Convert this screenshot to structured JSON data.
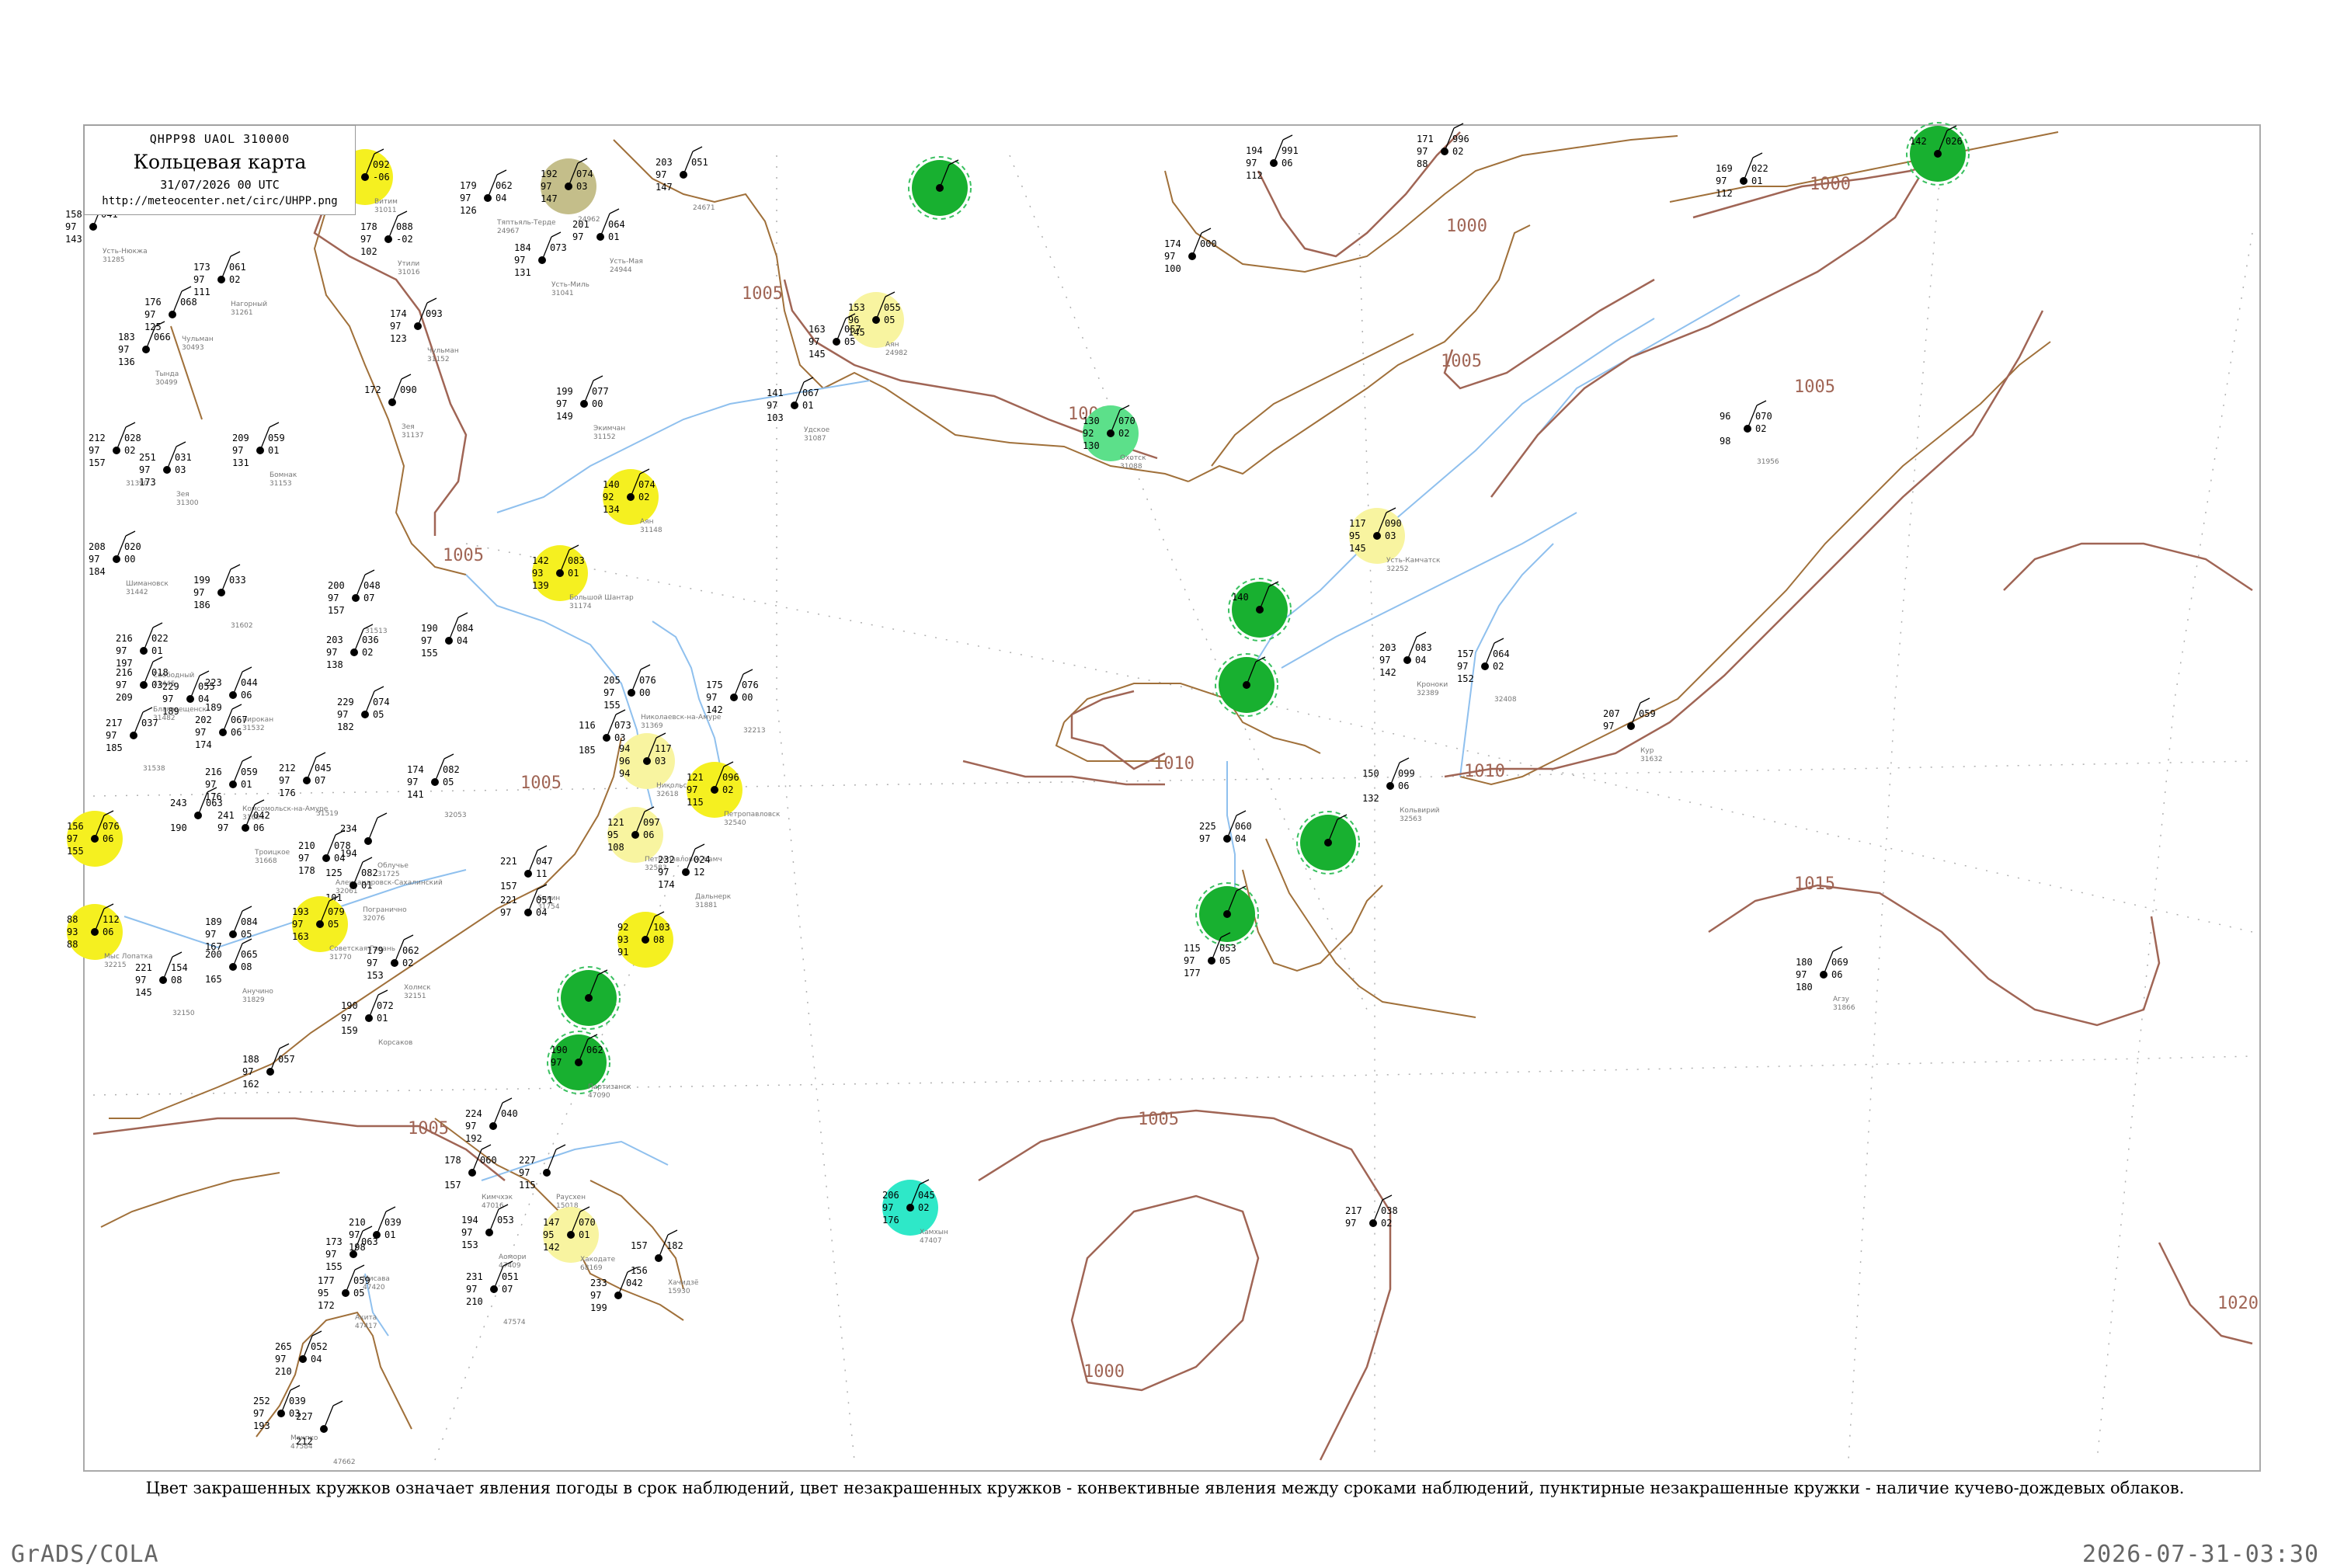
{
  "header": {
    "code": "QHPP98  UAOL  310000",
    "title": "Кольцевая карта",
    "datetime": "31/07/2026 00 UTC",
    "url": "http://meteocenter.net/circ/UHPP.png"
  },
  "caption": "Цвет закрашенных кружков означает явления погоды в срок наблюдений, цвет незакрашенных кружков - конвективные явления между сроками наблюдений, пунктирные незакрашенные кружки - наличие кучево-дождевых облаков.",
  "footer": {
    "left": "GrADS/COLA",
    "right": "2026-07-31-03:30"
  },
  "colors": {
    "yellow": "#f5f020",
    "light_yellow": "#f8f4a0",
    "green": "#18b030",
    "light_green": "#5ce08a",
    "cyan": "#2ee8c8",
    "khaki": "#c4be8a",
    "isobar": "#a06555",
    "coast": "#a0703a",
    "river": "#8fc0ee"
  },
  "isobar_labels": [
    "1005",
    "1005",
    "1005",
    "1005",
    "1010",
    "1010",
    "1000",
    "1000",
    "1005",
    "1000",
    "1015",
    "1020",
    "1005",
    "1005",
    "1000"
  ],
  "stations": [
    {
      "t": "162",
      "td": "97",
      "p": "120",
      "pp": "092",
      "dp": "-06",
      "name": "Витим",
      "id": "31011",
      "fill": "yellow"
    },
    {
      "t": "192",
      "td": "97",
      "p": "147",
      "pp": "074",
      "dp": "03",
      "name": "",
      "id": "24962",
      "fill": "khaki"
    },
    {
      "t": "203",
      "td": "97",
      "p": "147",
      "pp": "051",
      "dp": "",
      "name": "",
      "id": "24671",
      "fill": ""
    },
    {
      "t": "",
      "td": "",
      "p": "",
      "pp": "",
      "dp": "",
      "name": "",
      "id": "",
      "fill": "green"
    },
    {
      "t": "194",
      "td": "97",
      "p": "112",
      "pp": "991",
      "dp": "06",
      "name": "",
      "id": "",
      "fill": ""
    },
    {
      "t": "171",
      "td": "97",
      "p": "88",
      "pp": "996",
      "dp": "02",
      "name": "",
      "id": "",
      "fill": ""
    },
    {
      "t": "169",
      "td": "97",
      "p": "112",
      "pp": "022",
      "dp": "01",
      "name": "",
      "id": "",
      "fill": ""
    },
    {
      "t": "142",
      "td": "",
      "p": "",
      "pp": "026",
      "dp": "",
      "name": "",
      "id": "",
      "fill": "green"
    },
    {
      "t": "158",
      "td": "97",
      "p": "143",
      "pp": "041",
      "dp": "",
      "name": "Усть-Нюкжа",
      "id": "31285",
      "fill": ""
    },
    {
      "t": "179",
      "td": "97",
      "p": "126",
      "pp": "062",
      "dp": "04",
      "name": "Тяптьяль-Терде",
      "id": "24967",
      "fill": ""
    },
    {
      "t": "178",
      "td": "97",
      "p": "102",
      "pp": "088",
      "dp": "-02",
      "name": "Утили",
      "id": "31016",
      "fill": ""
    },
    {
      "t": "201",
      "td": "97",
      "p": "",
      "pp": "064",
      "dp": "01",
      "name": "Усть-Мая",
      "id": "24944",
      "fill": ""
    },
    {
      "t": "184",
      "td": "97",
      "p": "131",
      "pp": "073",
      "dp": "",
      "name": "Усть-Миль",
      "id": "31041",
      "fill": ""
    },
    {
      "t": "173",
      "td": "97",
      "p": "111",
      "pp": "061",
      "dp": "02",
      "name": "Нагорный",
      "id": "31261",
      "fill": ""
    },
    {
      "t": "176",
      "td": "97",
      "p": "125",
      "pp": "068",
      "dp": "",
      "name": "Чульман",
      "id": "30493",
      "fill": ""
    },
    {
      "t": "174",
      "td": "97",
      "p": "123",
      "pp": "093",
      "dp": "",
      "name": "Чульман",
      "id": "31152",
      "fill": ""
    },
    {
      "t": "174",
      "td": "97",
      "p": "100",
      "pp": "000",
      "dp": "",
      "name": "",
      "id": "",
      "fill": ""
    },
    {
      "t": "153",
      "td": "96",
      "p": "145",
      "pp": "055",
      "dp": "05",
      "name": "Аян",
      "id": "24982",
      "fill": "light_yellow"
    },
    {
      "t": "163",
      "td": "97",
      "p": "145",
      "pp": "057",
      "dp": "05",
      "name": "",
      "id": "",
      "fill": ""
    },
    {
      "t": "183",
      "td": "97",
      "p": "136",
      "pp": "066",
      "dp": "",
      "name": "Тында",
      "id": "30499",
      "fill": ""
    },
    {
      "t": "172",
      "td": "",
      "p": "",
      "pp": "090",
      "dp": "",
      "name": "Зея",
      "id": "31137",
      "fill": ""
    },
    {
      "t": "199",
      "td": "97",
      "p": "149",
      "pp": "077",
      "dp": "00",
      "name": "Экимчан",
      "id": "31152",
      "fill": ""
    },
    {
      "t": "141",
      "td": "97",
      "p": "103",
      "pp": "067",
      "dp": "01",
      "name": "Удское",
      "id": "31087",
      "fill": ""
    },
    {
      "t": "130",
      "td": "92",
      "p": "130",
      "pp": "070",
      "dp": "02",
      "name": "Охотск",
      "id": "31088",
      "fill": "light_green"
    },
    {
      "t": "96",
      "td": "",
      "p": "98",
      "pp": "070",
      "dp": "02",
      "name": "",
      "id": "31956",
      "fill": ""
    },
    {
      "t": "212",
      "td": "97",
      "p": "157",
      "pp": "028",
      "dp": "02",
      "name": "",
      "id": "31390",
      "fill": ""
    },
    {
      "t": "209",
      "td": "97",
      "p": "131",
      "pp": "059",
      "dp": "01",
      "name": "Бомнак",
      "id": "31153",
      "fill": ""
    },
    {
      "t": "251",
      "td": "97",
      "p": "173",
      "pp": "031",
      "dp": "03",
      "name": "Зея",
      "id": "31300",
      "fill": ""
    },
    {
      "t": "140",
      "td": "92",
      "p": "134",
      "pp": "074",
      "dp": "02",
      "name": "Аян",
      "id": "31148",
      "fill": "yellow"
    },
    {
      "t": "117",
      "td": "95",
      "p": "145",
      "pp": "090",
      "dp": "03",
      "name": "Усть-Камчатск",
      "id": "32252",
      "fill": "light_yellow"
    },
    {
      "t": "208",
      "td": "97",
      "p": "184",
      "pp": "020",
      "dp": "00",
      "name": "Шимановск",
      "id": "31442",
      "fill": ""
    },
    {
      "t": "199",
      "td": "97",
      "p": "186",
      "pp": "033",
      "dp": "",
      "name": "",
      "id": "31602",
      "fill": ""
    },
    {
      "t": "142",
      "td": "93",
      "p": "139",
      "pp": "083",
      "dp": "01",
      "name": "Большой Шантар",
      "id": "31174",
      "fill": "yellow"
    },
    {
      "t": "200",
      "td": "97",
      "p": "157",
      "pp": "048",
      "dp": "07",
      "name": "",
      "id": "31513",
      "fill": ""
    },
    {
      "t": "140",
      "td": "",
      "p": "",
      "pp": "",
      "dp": "",
      "name": "",
      "id": "",
      "fill": "green"
    },
    {
      "t": "216",
      "td": "97",
      "p": "197",
      "pp": "022",
      "dp": "01",
      "name": "Свободный",
      "id": "31445",
      "fill": ""
    },
    {
      "t": "203",
      "td": "97",
      "p": "138",
      "pp": "036",
      "dp": "02",
      "name": "",
      "id": "",
      "fill": ""
    },
    {
      "t": "190",
      "td": "97",
      "p": "155",
      "pp": "084",
      "dp": "04",
      "name": "",
      "id": "",
      "fill": ""
    },
    {
      "t": "203",
      "td": "97",
      "p": "142",
      "pp": "083",
      "dp": "04",
      "name": "Кроноки",
      "id": "32389",
      "fill": ""
    },
    {
      "t": "157",
      "td": "97",
      "p": "152",
      "pp": "064",
      "dp": "02",
      "name": "",
      "id": "32408",
      "fill": ""
    },
    {
      "t": "216",
      "td": "97",
      "p": "209",
      "pp": "018",
      "dp": "03",
      "name": "Благовещенск",
      "id": "31482",
      "fill": ""
    },
    {
      "t": "229",
      "td": "97",
      "p": "189",
      "pp": "055",
      "dp": "04",
      "name": "",
      "id": "",
      "fill": ""
    },
    {
      "t": "223",
      "td": "",
      "p": "189",
      "pp": "044",
      "dp": "06",
      "name": "Бирокан",
      "id": "31532",
      "fill": ""
    },
    {
      "t": "205",
      "td": "97",
      "p": "155",
      "pp": "076",
      "dp": "00",
      "name": "Николаевск-на-Амуре",
      "id": "31369",
      "fill": ""
    },
    {
      "t": "175",
      "td": "97",
      "p": "142",
      "pp": "076",
      "dp": "00",
      "name": "",
      "id": "32213",
      "fill": ""
    },
    {
      "t": "",
      "td": "",
      "p": "",
      "pp": "",
      "dp": "",
      "name": "",
      "id": "",
      "fill": "green"
    },
    {
      "t": "217",
      "td": "97",
      "p": "185",
      "pp": "037",
      "dp": "",
      "name": "",
      "id": "31538",
      "fill": ""
    },
    {
      "t": "202",
      "td": "97",
      "p": "174",
      "pp": "067",
      "dp": "06",
      "name": "",
      "id": "",
      "fill": ""
    },
    {
      "t": "229",
      "td": "97",
      "p": "182",
      "pp": "074",
      "dp": "05",
      "name": "",
      "id": "",
      "fill": ""
    },
    {
      "t": "116",
      "td": "",
      "p": "185",
      "pp": "073",
      "dp": "03",
      "name": "",
      "id": "",
      "fill": ""
    },
    {
      "t": "94",
      "td": "96",
      "p": "94",
      "pp": "117",
      "dp": "03",
      "name": "Никольское",
      "id": "32618",
      "fill": "light_yellow"
    },
    {
      "t": "207",
      "td": "97",
      "p": "",
      "pp": "059",
      "dp": "",
      "name": "Кур",
      "id": "31632",
      "fill": ""
    },
    {
      "t": "212",
      "td": "97",
      "p": "176",
      "pp": "045",
      "dp": "07",
      "name": "",
      "id": "31519",
      "fill": ""
    },
    {
      "t": "216",
      "td": "97",
      "p": "176",
      "pp": "059",
      "dp": "01",
      "name": "Комсомольск-на-Амуре",
      "id": "31664",
      "fill": ""
    },
    {
      "t": "174",
      "td": "97",
      "p": "141",
      "pp": "082",
      "dp": "05",
      "name": "",
      "id": "32053",
      "fill": ""
    },
    {
      "t": "121",
      "td": "97",
      "p": "115",
      "pp": "096",
      "dp": "02",
      "name": "Петропавловск",
      "id": "32540",
      "fill": "yellow"
    },
    {
      "t": "150",
      "td": "",
      "p": "132",
      "pp": "099",
      "dp": "06",
      "name": "Кольвирий",
      "id": "32563",
      "fill": ""
    },
    {
      "t": "225",
      "td": "97",
      "p": "",
      "pp": "060",
      "dp": "04",
      "name": "",
      "id": "",
      "fill": ""
    },
    {
      "t": "243",
      "td": "",
      "p": "190",
      "pp": "063",
      "dp": "",
      "name": "",
      "id": "",
      "fill": ""
    },
    {
      "t": "241",
      "td": "97",
      "p": "",
      "pp": "042",
      "dp": "06",
      "name": "Троицкое",
      "id": "31668",
      "fill": ""
    },
    {
      "t": "234",
      "td": "",
      "p": "194",
      "pp": "",
      "dp": "",
      "name": "Облучье",
      "id": "31725",
      "fill": ""
    },
    {
      "t": "210",
      "td": "97",
      "p": "178",
      "pp": "078",
      "dp": "04",
      "name": "Александровск-Сахалинский",
      "id": "32061",
      "fill": ""
    },
    {
      "t": "121",
      "td": "95",
      "p": "108",
      "pp": "097",
      "dp": "06",
      "name": "Петропавловск-Камч",
      "id": "32583",
      "fill": "light_yellow"
    },
    {
      "t": "",
      "td": "",
      "p": "",
      "pp": "",
      "dp": "",
      "name": "",
      "id": "",
      "fill": "green"
    },
    {
      "t": "156",
      "td": "97",
      "p": "155",
      "pp": "076",
      "dp": "06",
      "name": "",
      "id": "",
      "fill": "yellow"
    },
    {
      "t": "221",
      "td": "",
      "p": "157",
      "pp": "047",
      "dp": "11",
      "name": "Бикин",
      "id": "31754",
      "fill": ""
    },
    {
      "t": "125",
      "td": "",
      "p": "101",
      "pp": "082",
      "dp": "01",
      "name": "Погранично",
      "id": "32076",
      "fill": ""
    },
    {
      "t": "232",
      "td": "97",
      "p": "174",
      "pp": "024",
      "dp": "12",
      "name": "Дальнерк",
      "id": "31881",
      "fill": ""
    },
    {
      "t": "193",
      "td": "97",
      "p": "163",
      "pp": "079",
      "dp": "05",
      "name": "Советская Гавань",
      "id": "31770",
      "fill": "yellow"
    },
    {
      "t": "221",
      "td": "97",
      "p": "",
      "pp": "051",
      "dp": "04",
      "name": "",
      "id": "",
      "fill": ""
    },
    {
      "t": "189",
      "td": "97",
      "p": "167",
      "pp": "084",
      "dp": "05",
      "name": "",
      "id": "",
      "fill": ""
    },
    {
      "t": "92",
      "td": "93",
      "p": "91",
      "pp": "103",
      "dp": "08",
      "name": "",
      "id": "",
      "fill": "yellow"
    },
    {
      "t": "",
      "td": "",
      "p": "",
      "pp": "",
      "dp": "",
      "name": "",
      "id": "",
      "fill": "green"
    },
    {
      "t": "88",
      "td": "93",
      "p": "88",
      "pp": "112",
      "dp": "06",
      "name": "Мыс Лопатка",
      "id": "32215",
      "fill": "yellow"
    },
    {
      "t": "115",
      "td": "97",
      "p": "177",
      "pp": "053",
      "dp": "05",
      "name": "",
      "id": "",
      "fill": ""
    },
    {
      "t": "200",
      "td": "",
      "p": "165",
      "pp": "065",
      "dp": "08",
      "name": "Анучино",
      "id": "31829",
      "fill": ""
    },
    {
      "t": "179",
      "td": "97",
      "p": "153",
      "pp": "062",
      "dp": "02",
      "name": "Холмск",
      "id": "32151",
      "fill": ""
    },
    {
      "t": "",
      "td": "",
      "p": "",
      "pp": "",
      "dp": "",
      "name": "",
      "id": "",
      "fill": "green"
    },
    {
      "t": "221",
      "td": "97",
      "p": "145",
      "pp": "154",
      "dp": "08",
      "name": "",
      "id": "32150",
      "fill": ""
    },
    {
      "t": "180",
      "td": "97",
      "p": "180",
      "pp": "069",
      "dp": "06",
      "name": "Агзу",
      "id": "31866",
      "fill": ""
    },
    {
      "t": "190",
      "td": "97",
      "p": "159",
      "pp": "072",
      "dp": "01",
      "name": "Корсаков",
      "id": "",
      "fill": ""
    },
    {
      "t": "190",
      "td": "97",
      "p": "",
      "pp": "062",
      "dp": "",
      "name": "Партизанск",
      "id": "47090",
      "fill": "green"
    },
    {
      "t": "188",
      "td": "97",
      "p": "162",
      "pp": "057",
      "dp": "",
      "name": "",
      "id": "",
      "fill": ""
    },
    {
      "t": "224",
      "td": "97",
      "p": "192",
      "pp": "040",
      "dp": "",
      "name": "",
      "id": "",
      "fill": ""
    },
    {
      "t": "178",
      "td": "",
      "p": "157",
      "pp": "060",
      "dp": "",
      "name": "Кимчхэк",
      "id": "47016",
      "fill": ""
    },
    {
      "t": "227",
      "td": "97",
      "p": "115",
      "pp": "",
      "dp": "",
      "name": "Раусхен",
      "id": "15018",
      "fill": ""
    },
    {
      "t": "206",
      "td": "97",
      "p": "176",
      "pp": "045",
      "dp": "02",
      "name": "Хамхын",
      "id": "47407",
      "fill": "cyan"
    },
    {
      "t": "194",
      "td": "97",
      "p": "153",
      "pp": "053",
      "dp": "",
      "name": "Аомори",
      "id": "47409",
      "fill": ""
    },
    {
      "t": "147",
      "td": "95",
      "p": "142",
      "pp": "070",
      "dp": "01",
      "name": "Хакодате",
      "id": "68169",
      "fill": "light_yellow"
    },
    {
      "t": "157",
      "td": "",
      "p": "156",
      "pp": "182",
      "dp": "",
      "name": "Хачидзё",
      "id": "15930",
      "fill": ""
    },
    {
      "t": "217",
      "td": "97",
      "p": "",
      "pp": "038",
      "dp": "02",
      "name": "",
      "id": "",
      "fill": ""
    },
    {
      "t": "210",
      "td": "97",
      "p": "198",
      "pp": "039",
      "dp": "01",
      "name": "",
      "id": "",
      "fill": ""
    },
    {
      "t": "173",
      "td": "97",
      "p": "155",
      "pp": "063",
      "dp": "",
      "name": "Мисава",
      "id": "47420",
      "fill": ""
    },
    {
      "t": "233",
      "td": "97",
      "p": "199",
      "pp": "042",
      "dp": "",
      "name": "",
      "id": "",
      "fill": ""
    },
    {
      "t": "177",
      "td": "95",
      "p": "172",
      "pp": "059",
      "dp": "05",
      "name": "Акита",
      "id": "47417",
      "fill": ""
    },
    {
      "t": "231",
      "td": "97",
      "p": "210",
      "pp": "051",
      "dp": "07",
      "name": "",
      "id": "47574",
      "fill": ""
    },
    {
      "t": "265",
      "td": "97",
      "p": "210",
      "pp": "052",
      "dp": "04",
      "name": "",
      "id": "",
      "fill": ""
    },
    {
      "t": "252",
      "td": "97",
      "p": "193",
      "pp": "039",
      "dp": "03",
      "name": "Мокпхо",
      "id": "47584",
      "fill": ""
    },
    {
      "t": "227",
      "td": "",
      "p": "212",
      "pp": "",
      "dp": "",
      "name": "",
      "id": "47662",
      "fill": ""
    }
  ]
}
